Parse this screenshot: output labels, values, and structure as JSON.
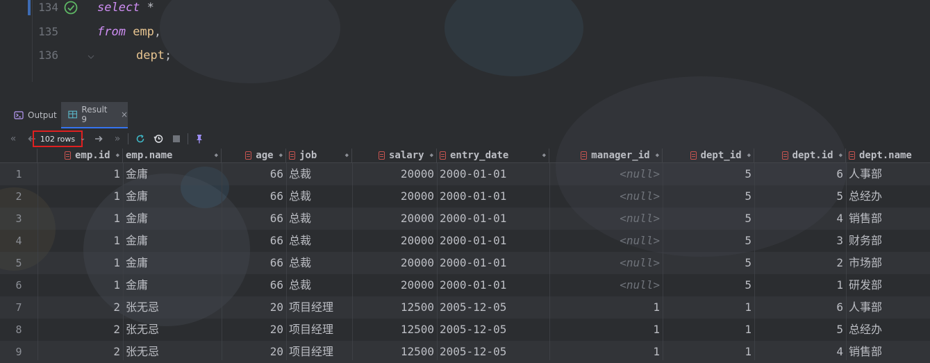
{
  "editor": {
    "lines": [
      {
        "num": "134",
        "kw": "select",
        "rest": " *"
      },
      {
        "num": "135",
        "kw": "from",
        "table": "emp",
        "rest": ","
      },
      {
        "num": "136",
        "kw": "",
        "table": "dept",
        "rest": ";"
      }
    ]
  },
  "tabs": {
    "output": "Output",
    "result": "Result 9",
    "close": "×"
  },
  "toolbar": {
    "rows_label": "102 rows",
    "first": "«",
    "prev": "‹",
    "next": "→",
    "last": "»"
  },
  "grid": {
    "columns": [
      "emp.id",
      "emp.name",
      "age",
      "job",
      "salary",
      "entry_date",
      "manager_id",
      "dept_id",
      "dept.id",
      "dept.name"
    ],
    "rows": [
      {
        "n": "1",
        "emp_id": "1",
        "emp_name": "金庸",
        "age": "66",
        "job": "总裁",
        "salary": "20000",
        "entry_date": "2000-01-01",
        "manager_id": "<null>",
        "dept_id": "5",
        "dept_id2": "6",
        "dept_name": "人事部"
      },
      {
        "n": "2",
        "emp_id": "1",
        "emp_name": "金庸",
        "age": "66",
        "job": "总裁",
        "salary": "20000",
        "entry_date": "2000-01-01",
        "manager_id": "<null>",
        "dept_id": "5",
        "dept_id2": "5",
        "dept_name": "总经办"
      },
      {
        "n": "3",
        "emp_id": "1",
        "emp_name": "金庸",
        "age": "66",
        "job": "总裁",
        "salary": "20000",
        "entry_date": "2000-01-01",
        "manager_id": "<null>",
        "dept_id": "5",
        "dept_id2": "4",
        "dept_name": "销售部"
      },
      {
        "n": "4",
        "emp_id": "1",
        "emp_name": "金庸",
        "age": "66",
        "job": "总裁",
        "salary": "20000",
        "entry_date": "2000-01-01",
        "manager_id": "<null>",
        "dept_id": "5",
        "dept_id2": "3",
        "dept_name": "财务部"
      },
      {
        "n": "5",
        "emp_id": "1",
        "emp_name": "金庸",
        "age": "66",
        "job": "总裁",
        "salary": "20000",
        "entry_date": "2000-01-01",
        "manager_id": "<null>",
        "dept_id": "5",
        "dept_id2": "2",
        "dept_name": "市场部"
      },
      {
        "n": "6",
        "emp_id": "1",
        "emp_name": "金庸",
        "age": "66",
        "job": "总裁",
        "salary": "20000",
        "entry_date": "2000-01-01",
        "manager_id": "<null>",
        "dept_id": "5",
        "dept_id2": "1",
        "dept_name": "研发部"
      },
      {
        "n": "7",
        "emp_id": "2",
        "emp_name": "张无忌",
        "age": "20",
        "job": "项目经理",
        "salary": "12500",
        "entry_date": "2005-12-05",
        "manager_id": "1",
        "dept_id": "1",
        "dept_id2": "6",
        "dept_name": "人事部"
      },
      {
        "n": "8",
        "emp_id": "2",
        "emp_name": "张无忌",
        "age": "20",
        "job": "项目经理",
        "salary": "12500",
        "entry_date": "2005-12-05",
        "manager_id": "1",
        "dept_id": "1",
        "dept_id2": "5",
        "dept_name": "总经办"
      },
      {
        "n": "9",
        "emp_id": "2",
        "emp_name": "张无忌",
        "age": "20",
        "job": "项目经理",
        "salary": "12500",
        "entry_date": "2005-12-05",
        "manager_id": "1",
        "dept_id": "1",
        "dept_id2": "4",
        "dept_name": "销售部"
      }
    ]
  }
}
